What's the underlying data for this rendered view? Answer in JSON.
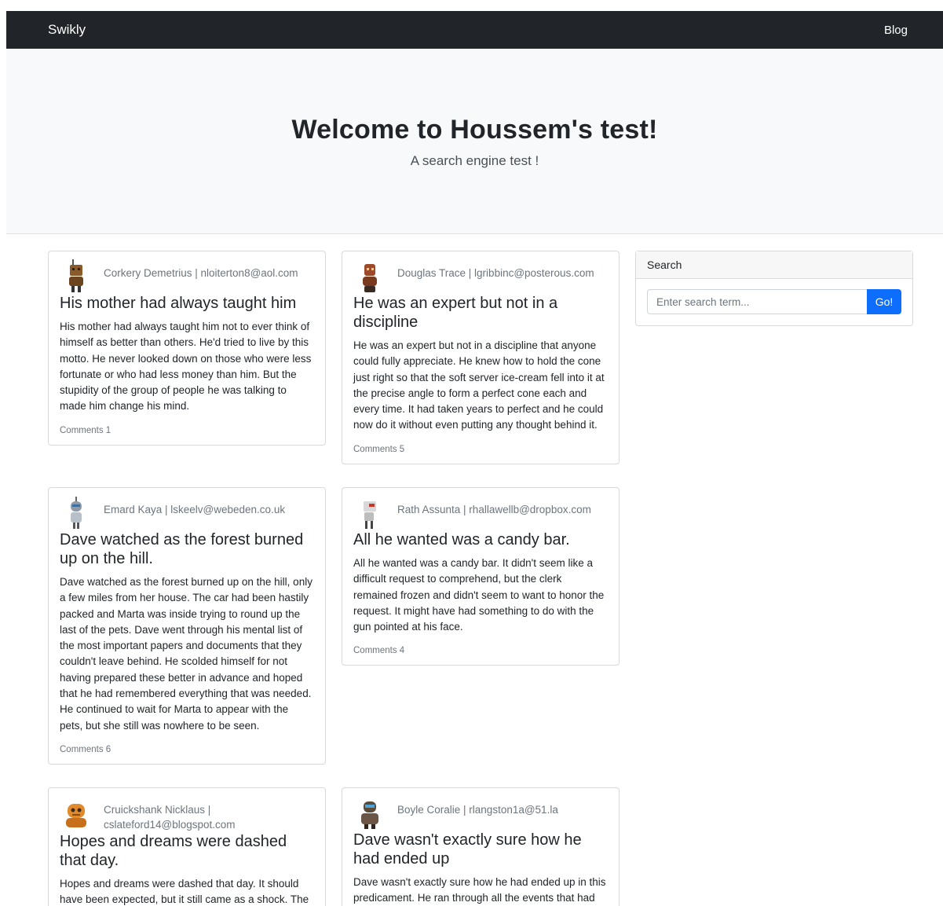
{
  "navbar": {
    "brand": "Swikly",
    "links": [
      "Blog"
    ]
  },
  "hero": {
    "title": "Welcome to Houssem's test!",
    "subtitle": "A search engine test !"
  },
  "search": {
    "header": "Search",
    "placeholder": "Enter search term...",
    "button": "Go!"
  },
  "posts": [
    {
      "author": "Corkery Demetrius | nloiterton8@aol.com",
      "avatar_icon": "robot-avatar-icon",
      "avatar_color": "#8a5a2b",
      "title": "His mother had always taught him",
      "excerpt": "His mother had always taught him not to ever think of himself as better than others. He'd tried to live by this motto. He never looked down on those who were less fortunate or who had less money than him. But the stupidity of the group of people he was talking to made him change his mind.",
      "comments": "Comments 1"
    },
    {
      "author": "Douglas Trace | lgribbinc@posterous.com",
      "avatar_icon": "robot-avatar-icon",
      "avatar_color": "#9c4a2a",
      "title": "He was an expert but not in a discipline",
      "excerpt": "He was an expert but not in a discipline that anyone could fully appreciate. He knew how to hold the cone just right so that the soft server ice-cream fell into it at the precise angle to form a perfect cone each and every time. It had taken years to perfect and he could now do it without even putting any thought behind it.",
      "comments": "Comments 5"
    },
    {
      "author": "Emard Kaya | lskeelv@webeden.co.uk",
      "avatar_icon": "robot-avatar-icon",
      "avatar_color": "#8f9aa6",
      "title": "Dave watched as the forest burned up on the hill.",
      "excerpt": "Dave watched as the forest burned up on the hill, only a few miles from her house. The car had been hastily packed and Marta was inside trying to round up the last of the pets. Dave went through his mental list of the most important papers and documents that they couldn't leave behind. He scolded himself for not having prepared these better in advance and hoped that he had remembered everything that was needed. He continued to wait for Marta to appear with the pets, but she still was nowhere to be seen.",
      "comments": "Comments 6"
    },
    {
      "author": "Rath Assunta | rhallawellb@dropbox.com",
      "avatar_icon": "robot-avatar-icon",
      "avatar_color": "#c9c9c9",
      "title": "All he wanted was a candy bar.",
      "excerpt": "All he wanted was a candy bar. It didn't seem like a difficult request to comprehend, but the clerk remained frozen and didn't seem to want to honor the request. It might have had something to do with the gun pointed at his face.",
      "comments": "Comments 4"
    },
    {
      "author": "Cruickshank Nicklaus | cslateford14@blogspot.com",
      "avatar_icon": "robot-avatar-icon",
      "avatar_color": "#e08a2c",
      "title": "Hopes and dreams were dashed that day.",
      "excerpt": "Hopes and dreams were dashed that day. It should have been expected, but it still came as a shock. The",
      "comments": ""
    },
    {
      "author": "Boyle Coralie | rlangston1a@51.la",
      "avatar_icon": "robot-avatar-icon",
      "avatar_color": "#5a4a3a",
      "title": "Dave wasn't exactly sure how he had ended up",
      "excerpt": "Dave wasn't exactly sure how he had ended up in this predicament. He ran through all the events that had",
      "comments": ""
    }
  ]
}
